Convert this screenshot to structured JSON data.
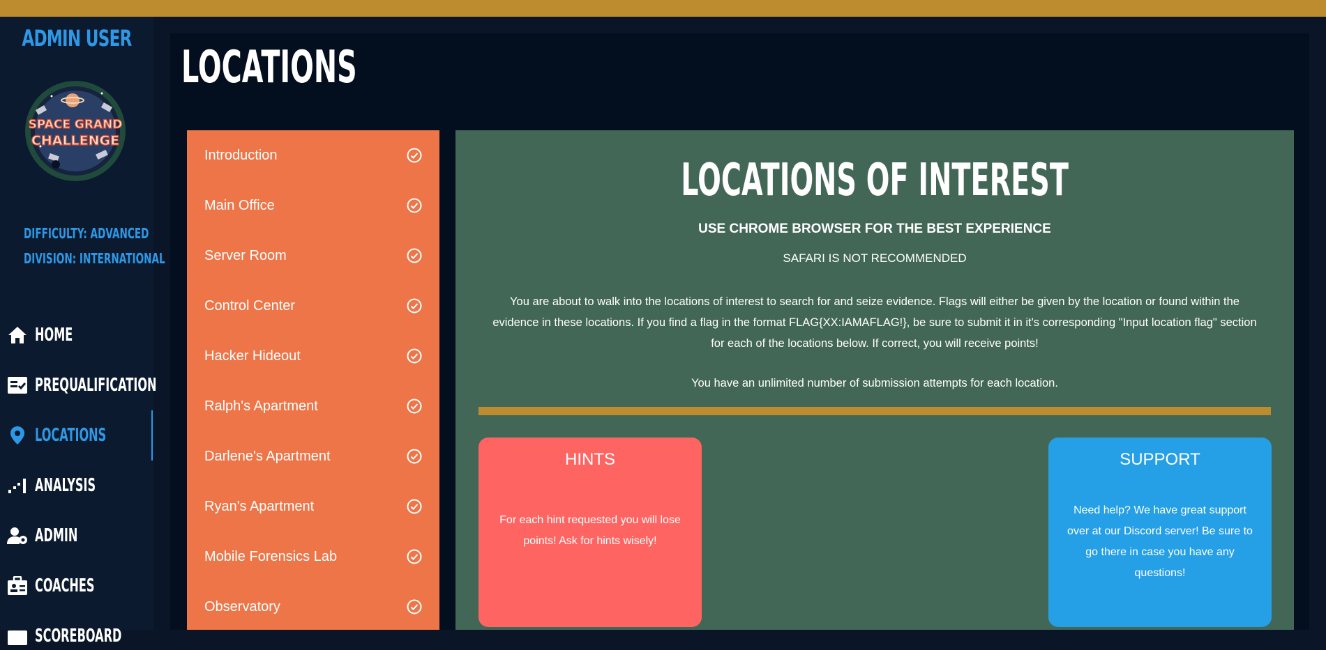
{
  "colors": {
    "top_bar": "#bc8c2e",
    "sidebar_bg": "#0b1a2e",
    "main_bg": "#030f1e",
    "accent_blue": "#2f98e6",
    "locations_list_bg": "#ed7548",
    "panel_bg": "#436756",
    "divider": "#bc8c2e",
    "hints_card": "#fe6562",
    "support_card": "#259fe6"
  },
  "sidebar": {
    "user_name": "ADMIN USER",
    "logo": {
      "icon": "space-grand-challenge-logo",
      "text_line1": "SPACE GRAND",
      "text_line2": "CHALLENGE"
    },
    "difficulty": "DIFFICULTY: ADVANCED",
    "division": "DIVISION: INTERNATIONAL",
    "nav": [
      {
        "label": "HOME",
        "icon": "home-icon",
        "active": false
      },
      {
        "label": "PREQUALIFICATION",
        "icon": "checklist-icon",
        "active": false
      },
      {
        "label": "LOCATIONS",
        "icon": "map-pin-icon",
        "active": true
      },
      {
        "label": "ANALYSIS",
        "icon": "analysis-icon",
        "active": false
      },
      {
        "label": "ADMIN",
        "icon": "user-gear-icon",
        "active": false
      },
      {
        "label": "COACHES",
        "icon": "id-badge-icon",
        "active": false
      },
      {
        "label": "SCOREBOARD",
        "icon": "scoreboard-icon",
        "active": false
      }
    ]
  },
  "page": {
    "title": "LOCATIONS"
  },
  "locations": [
    {
      "name": "Introduction",
      "icon": "check-circle-icon"
    },
    {
      "name": "Main Office",
      "icon": "check-circle-icon"
    },
    {
      "name": "Server Room",
      "icon": "check-circle-icon"
    },
    {
      "name": "Control Center",
      "icon": "check-circle-icon"
    },
    {
      "name": "Hacker Hideout",
      "icon": "check-circle-icon"
    },
    {
      "name": "Ralph's Apartment",
      "icon": "check-circle-icon"
    },
    {
      "name": "Darlene's Apartment",
      "icon": "check-circle-icon"
    },
    {
      "name": "Ryan's Apartment",
      "icon": "check-circle-icon"
    },
    {
      "name": "Mobile Forensics Lab",
      "icon": "check-circle-icon"
    },
    {
      "name": "Observatory",
      "icon": "check-circle-icon"
    }
  ],
  "panel": {
    "title": "LOCATIONS OF INTEREST",
    "subtitle": "USE CHROME BROWSER FOR THE BEST EXPERIENCE",
    "note": "SAFARI IS NOT RECOMMENDED",
    "intro": "You are about to walk into the locations of interest to search for and seize evidence. Flags will either be given by the location or found within the evidence in these locations. If you find a flag in the format FLAG{XX:IAMAFLAG!}, be sure to submit it in it's corresponding \"Input location flag\" section for each of the locations below. If correct, you will receive points!",
    "attempts": "You have an unlimited number of submission attempts for each location."
  },
  "cards": {
    "hints": {
      "title": "HINTS",
      "body": "For each hint requested you will lose points! Ask for hints wisely!"
    },
    "support": {
      "title": "SUPPORT",
      "body": "Need help? We have great support over at our Discord server! Be sure to go there in case you have any questions!"
    }
  }
}
